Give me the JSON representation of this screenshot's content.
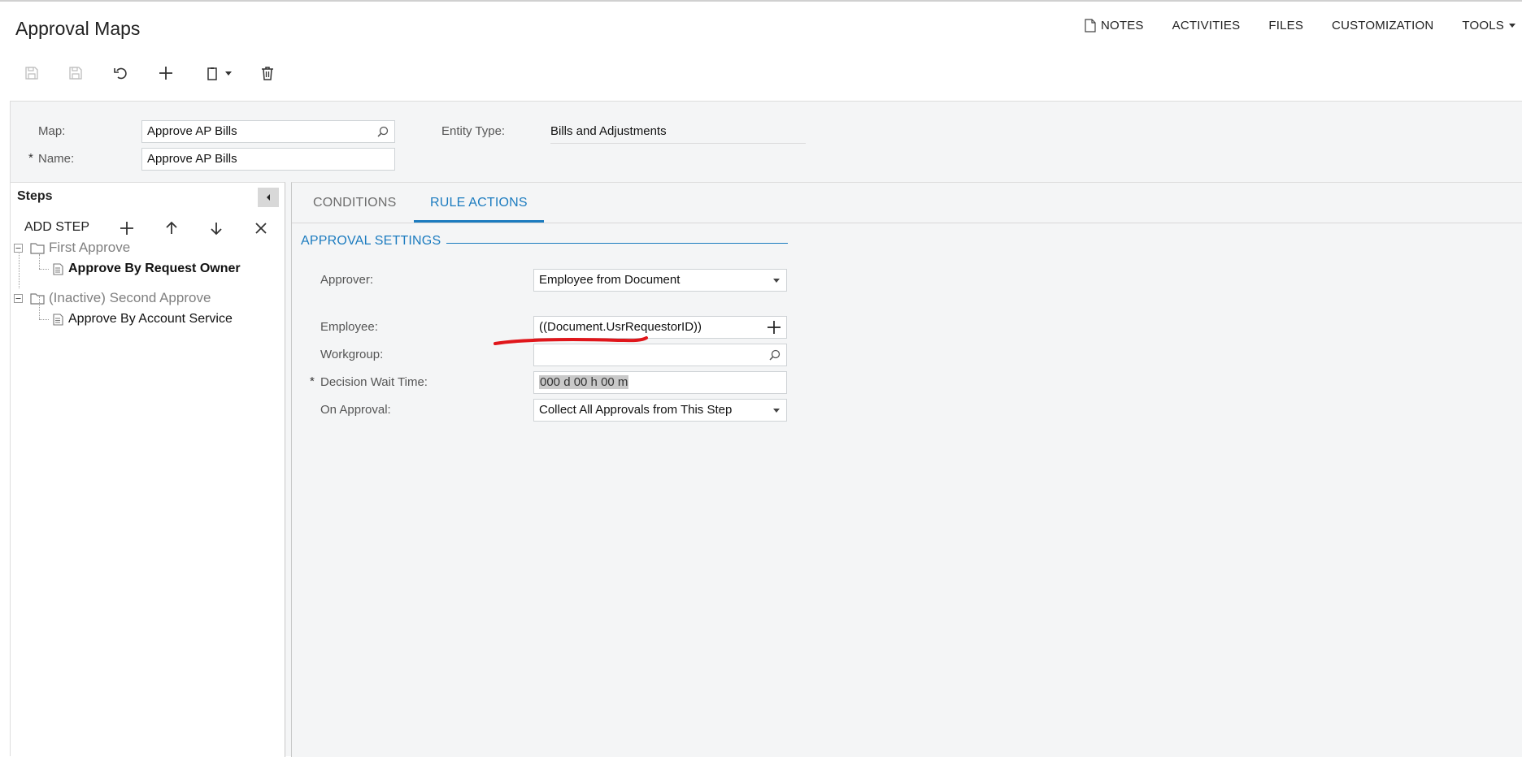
{
  "header": {
    "title": "Approval Maps",
    "nav": {
      "notes": "NOTES",
      "activities": "ACTIVITIES",
      "files": "FILES",
      "customization": "CUSTOMIZATION",
      "tools": "TOOLS"
    }
  },
  "toolbar": {
    "icons": [
      "save-all-icon",
      "save-icon",
      "undo-icon",
      "add-icon",
      "copy-paste-icon",
      "delete-icon"
    ]
  },
  "form": {
    "map_label": "Map:",
    "map_value": "Approve AP Bills",
    "name_required": "*",
    "name_label": "Name:",
    "name_value": "Approve AP Bills",
    "entity_type_label": "Entity Type:",
    "entity_type_value": "Bills and Adjustments"
  },
  "steps": {
    "title": "Steps",
    "add_step": "ADD STEP",
    "tree": [
      {
        "label": "First Approve",
        "children": [
          {
            "label": "Approve By Request Owner",
            "selected": true
          }
        ]
      },
      {
        "label": "(Inactive) Second Approve",
        "children": [
          {
            "label": "Approve By Account Service",
            "selected": false
          }
        ]
      }
    ]
  },
  "tabs": {
    "conditions": "CONDITIONS",
    "rule_actions": "RULE ACTIONS",
    "active": "RULE ACTIONS"
  },
  "approval_settings": {
    "title": "APPROVAL SETTINGS",
    "approver_label": "Approver:",
    "approver_value": "Employee from Document",
    "employee_label": "Employee:",
    "employee_value": "((Document.UsrRequestorID))",
    "workgroup_label": "Workgroup:",
    "workgroup_value": "",
    "decision_required": "*",
    "decision_label": "Decision Wait Time:",
    "decision_value": "000 d 00 h 00 m",
    "on_approval_label": "On Approval:",
    "on_approval_value": "Collect All Approvals from This Step"
  },
  "colors": {
    "accent": "#1b7bbf",
    "annotation": "#e0161b",
    "panel_bg": "#f4f5f6"
  }
}
